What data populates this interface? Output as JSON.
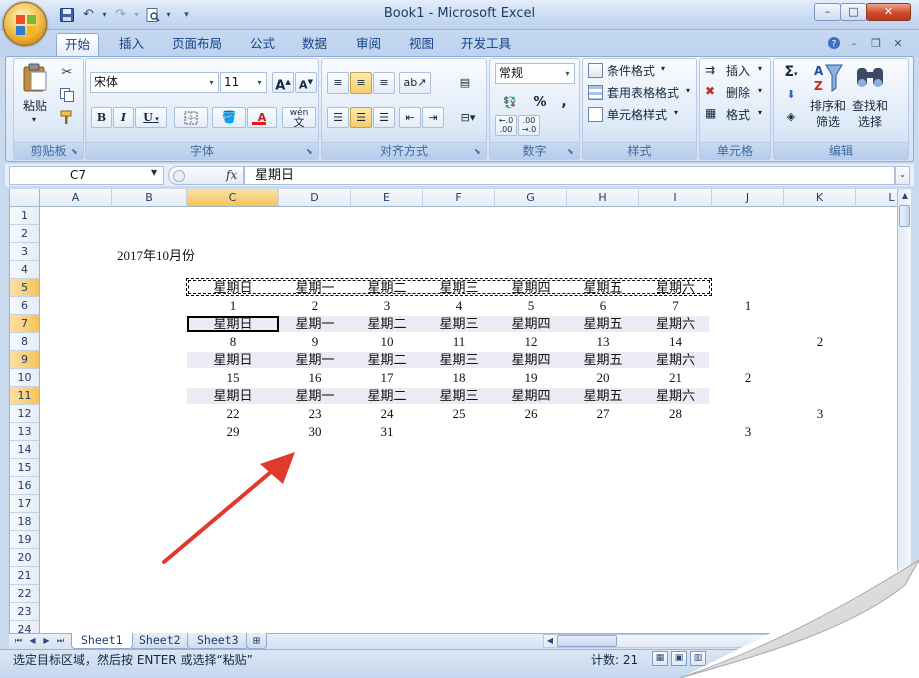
{
  "window": {
    "title": "Book1 - Microsoft Excel",
    "minimize": "–",
    "maximize": "□",
    "close": "✕"
  },
  "quick_access": {
    "save_icon": "save-icon",
    "undo_icon": "undo-icon",
    "redo_icon": "redo-icon",
    "print_preview_icon": "print-preview-icon",
    "customize_icon": "chevron-down-icon"
  },
  "tabs": [
    "开始",
    "插入",
    "页面布局",
    "公式",
    "数据",
    "审阅",
    "视图",
    "开发工具"
  ],
  "ribbon": {
    "clipboard": {
      "label": "剪贴板",
      "paste": "粘贴"
    },
    "font": {
      "label": "字体",
      "font_name": "宋体",
      "font_size": "11",
      "bold": "B",
      "italic": "I",
      "underline": "U",
      "grow": "A",
      "shrink": "A",
      "font_color_letter": "A",
      "phonetic": "wén"
    },
    "alignment": {
      "label": "对齐方式"
    },
    "number": {
      "label": "数字",
      "format": "常规",
      "percent": "%",
      "comma": ","
    },
    "styles": {
      "label": "样式",
      "conditional": "条件格式",
      "table_format": "套用表格格式",
      "cell_styles": "单元格样式"
    },
    "cells": {
      "label": "单元格",
      "insert": "插入",
      "delete": "删除",
      "format": "格式"
    },
    "editing": {
      "label": "编辑",
      "sigma": "Σ",
      "sort_filter": "排序和",
      "sort_filter2": "筛选",
      "find_select": "查找和",
      "find_select2": "选择"
    }
  },
  "formula_bar": {
    "name_box": "C7",
    "fx": "fx",
    "content": "星期日"
  },
  "columns": [
    "A",
    "B",
    "C",
    "D",
    "E",
    "F",
    "G",
    "H",
    "I",
    "J",
    "K",
    "L"
  ],
  "rows": [
    "1",
    "2",
    "3",
    "4",
    "5",
    "6",
    "7",
    "8",
    "9",
    "10",
    "11",
    "12",
    "13",
    "14",
    "15",
    "16",
    "17",
    "18",
    "19",
    "20",
    "21",
    "22",
    "23",
    "24"
  ],
  "sheet": {
    "title": "2017年10月份",
    "weekdays": [
      "星期日",
      "星期一",
      "星期二",
      "星期三",
      "星期四",
      "星期五",
      "星期六"
    ],
    "week1": [
      "1",
      "2",
      "3",
      "4",
      "5",
      "6",
      "7"
    ],
    "week2": [
      "8",
      "9",
      "10",
      "11",
      "12",
      "13",
      "14"
    ],
    "week3": [
      "15",
      "16",
      "17",
      "18",
      "19",
      "20",
      "21"
    ],
    "week4": [
      "22",
      "23",
      "24",
      "25",
      "26",
      "27",
      "28"
    ],
    "week5": [
      "29",
      "30",
      "31"
    ],
    "j6": "1",
    "k8": "2",
    "j10": "2",
    "k12": "3",
    "j13": "3"
  },
  "sheet_tabs": [
    "Sheet1",
    "Sheet2",
    "Sheet3"
  ],
  "status": {
    "message": "选定目标区域，然后按 ENTER 或选择“粘贴”",
    "count": "计数: 21"
  },
  "colors": {
    "arrow": "#e03a2f",
    "selected_header": "#f6c35d",
    "band": "#ebebf5"
  }
}
